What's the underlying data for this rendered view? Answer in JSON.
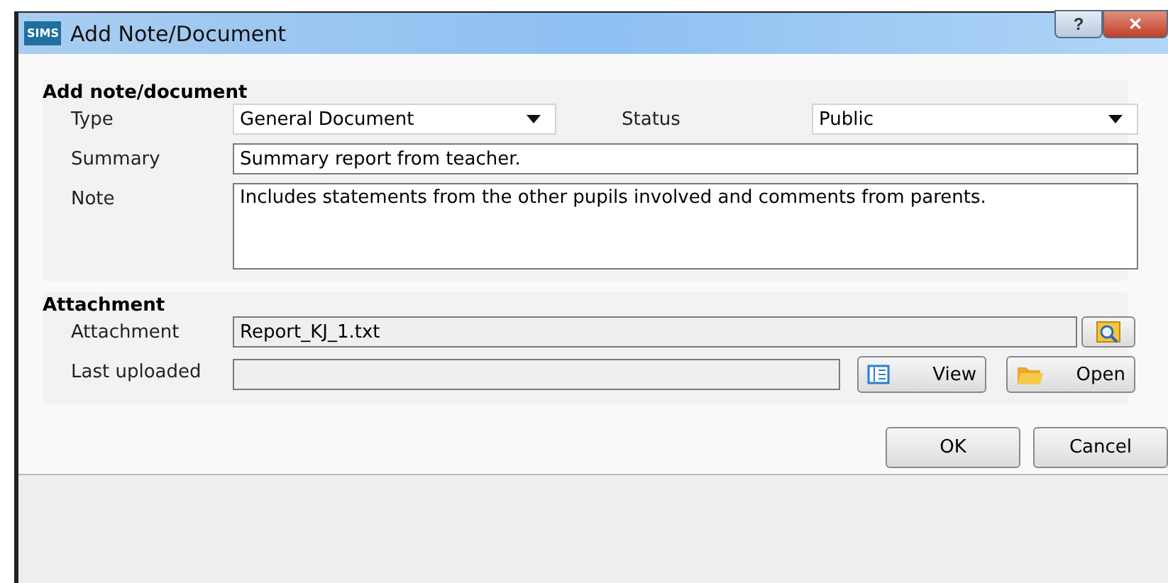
{
  "window": {
    "logo": "SIMS",
    "title": "Add Note/Document",
    "help": "?",
    "close": "✕"
  },
  "note_section": {
    "heading": "Add note/document",
    "type": {
      "label": "Type",
      "value": "General Document"
    },
    "status": {
      "label": "Status",
      "value": "Public"
    },
    "summary": {
      "label": "Summary",
      "value": "Summary report from teacher."
    },
    "note": {
      "label": "Note",
      "value": "Includes statements from the other pupils involved and comments from parents."
    }
  },
  "attachment_section": {
    "heading": "Attachment",
    "attachment": {
      "label": "Attachment",
      "value": "Report_KJ_1.txt"
    },
    "last_uploaded": {
      "label": "Last uploaded"
    },
    "view_button": "View",
    "open_button": "Open"
  },
  "buttons": [
    "OK",
    "Cancel"
  ]
}
